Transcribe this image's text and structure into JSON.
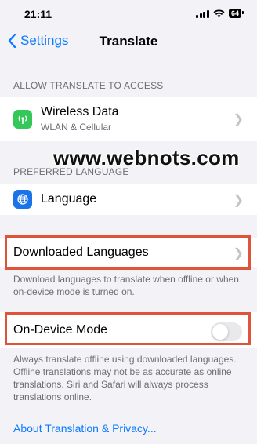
{
  "status_bar": {
    "time": "21:11",
    "battery": "64"
  },
  "nav": {
    "back_label": "Settings",
    "title": "Translate"
  },
  "sections": {
    "access_header": "ALLOW TRANSLATE TO ACCESS",
    "preferred_header": "PREFERRED LANGUAGE"
  },
  "rows": {
    "wireless": {
      "title": "Wireless Data",
      "subtitle": "WLAN & Cellular",
      "icon": "antenna-icon",
      "icon_color": "#34c759"
    },
    "language": {
      "title": "Language",
      "icon": "globe-icon",
      "icon_color": "#1a73e8"
    },
    "downloaded": {
      "title": "Downloaded Languages"
    },
    "on_device": {
      "title": "On-Device Mode",
      "toggle_on": false
    }
  },
  "footers": {
    "downloaded": "Download languages to translate when offline or when on-device mode is turned on.",
    "on_device": "Always translate offline using downloaded languages. Offline translations may not be as accurate as online translations. Siri and Safari will always process translations online."
  },
  "watermark": "www.webnots.com",
  "link": "About Translation & Privacy...",
  "colors": {
    "accent": "#0a7aff",
    "highlight": "#e0533b"
  }
}
